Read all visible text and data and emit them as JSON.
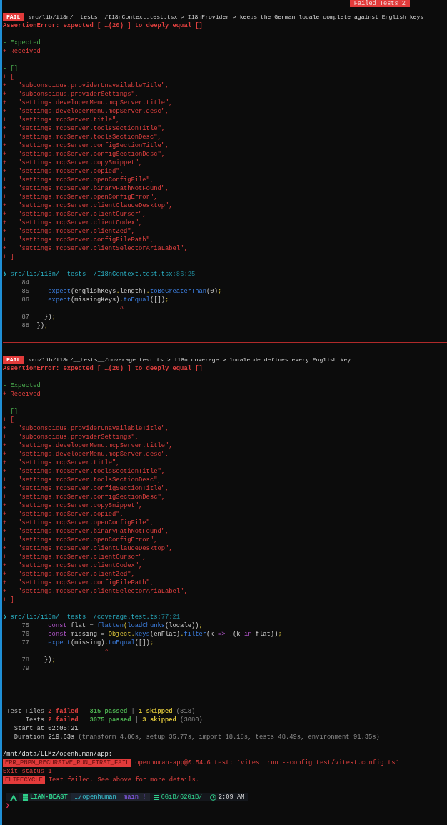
{
  "top_badge": {
    "label": "Failed Tests 2"
  },
  "failures": [
    {
      "badge": "FAIL",
      "header": "src/lib/i18n/__tests__/I18nContext.test.tsx > I18nProvider > keeps the German locale complete against English keys",
      "error": "AssertionError: expected [ …(20) ] to deeply equal []",
      "legend": [
        {
          "kind": "removed",
          "text": "- Expected"
        },
        {
          "kind": "added",
          "text": "+ Received"
        }
      ],
      "diff": [
        {
          "kind": "removed",
          "text": "- []"
        },
        {
          "kind": "added",
          "text": "+ ["
        },
        {
          "kind": "added",
          "text": "+   \"subconscious.providerUnavailableTitle\","
        },
        {
          "kind": "added",
          "text": "+   \"subconscious.providerSettings\","
        },
        {
          "kind": "added",
          "text": "+   \"settings.developerMenu.mcpServer.title\","
        },
        {
          "kind": "added",
          "text": "+   \"settings.developerMenu.mcpServer.desc\","
        },
        {
          "kind": "added",
          "text": "+   \"settings.mcpServer.title\","
        },
        {
          "kind": "added",
          "text": "+   \"settings.mcpServer.toolsSectionTitle\","
        },
        {
          "kind": "added",
          "text": "+   \"settings.mcpServer.toolsSectionDesc\","
        },
        {
          "kind": "added",
          "text": "+   \"settings.mcpServer.configSectionTitle\","
        },
        {
          "kind": "added",
          "text": "+   \"settings.mcpServer.configSectionDesc\","
        },
        {
          "kind": "added",
          "text": "+   \"settings.mcpServer.copySnippet\","
        },
        {
          "kind": "added",
          "text": "+   \"settings.mcpServer.copied\","
        },
        {
          "kind": "added",
          "text": "+   \"settings.mcpServer.openConfigFile\","
        },
        {
          "kind": "added",
          "text": "+   \"settings.mcpServer.binaryPathNotFound\","
        },
        {
          "kind": "added",
          "text": "+   \"settings.mcpServer.openConfigError\","
        },
        {
          "kind": "added",
          "text": "+   \"settings.mcpServer.clientClaudeDesktop\","
        },
        {
          "kind": "added",
          "text": "+   \"settings.mcpServer.clientCursor\","
        },
        {
          "kind": "added",
          "text": "+   \"settings.mcpServer.clientCodex\","
        },
        {
          "kind": "added",
          "text": "+   \"settings.mcpServer.clientZed\","
        },
        {
          "kind": "added",
          "text": "+   \"settings.mcpServer.configFilePath\","
        },
        {
          "kind": "added",
          "text": "+   \"settings.mcpServer.clientSelectorAriaLabel\","
        },
        {
          "kind": "added",
          "text": "+ ]"
        }
      ],
      "location": {
        "marker": "❯",
        "path": "src/lib/i18n/__tests__/I18nContext.test.tsx",
        "position": ":86:25"
      },
      "code": [
        {
          "gutter": "84|"
        },
        {
          "gutter": "85|",
          "tokens": [
            {
              "kind": "fn",
              "t": "    expect"
            },
            {
              "kind": "plain",
              "t": "(englishKeys"
            },
            {
              "kind": "punct",
              "t": "."
            },
            {
              "kind": "plain",
              "t": "length)"
            },
            {
              "kind": "punct",
              "t": "."
            },
            {
              "kind": "fn",
              "t": "toBeGreaterThan"
            },
            {
              "kind": "plain",
              "t": "(0)"
            },
            {
              "kind": "punct",
              "t": ";"
            }
          ]
        },
        {
          "gutter": "86|",
          "tokens": [
            {
              "kind": "fn",
              "t": "    expect"
            },
            {
              "kind": "plain",
              "t": "(missingKeys)"
            },
            {
              "kind": "punct",
              "t": "."
            },
            {
              "kind": "fn",
              "t": "toEqual"
            },
            {
              "kind": "plain",
              "t": "([])"
            },
            {
              "kind": "punct",
              "t": ";"
            }
          ]
        },
        {
          "gutter": "|",
          "caret": "                       ^"
        },
        {
          "gutter": "87|",
          "tokens": [
            {
              "kind": "plain",
              "t": "   })"
            },
            {
              "kind": "punct",
              "t": ";"
            }
          ]
        },
        {
          "gutter": "88|",
          "tokens": [
            {
              "kind": "plain",
              "t": " })"
            },
            {
              "kind": "punct",
              "t": ";"
            }
          ]
        }
      ]
    },
    {
      "badge": "FAIL",
      "header": "src/lib/i18n/__tests__/coverage.test.ts > i18n coverage > locale de defines every English key",
      "error": "AssertionError: expected [ …(20) ] to deeply equal []",
      "legend": [
        {
          "kind": "removed",
          "text": "- Expected"
        },
        {
          "kind": "added",
          "text": "+ Received"
        }
      ],
      "diff": [
        {
          "kind": "removed",
          "text": "- []"
        },
        {
          "kind": "added",
          "text": "+ ["
        },
        {
          "kind": "added",
          "text": "+   \"subconscious.providerUnavailableTitle\","
        },
        {
          "kind": "added",
          "text": "+   \"subconscious.providerSettings\","
        },
        {
          "kind": "added",
          "text": "+   \"settings.developerMenu.mcpServer.title\","
        },
        {
          "kind": "added",
          "text": "+   \"settings.developerMenu.mcpServer.desc\","
        },
        {
          "kind": "added",
          "text": "+   \"settings.mcpServer.title\","
        },
        {
          "kind": "added",
          "text": "+   \"settings.mcpServer.toolsSectionTitle\","
        },
        {
          "kind": "added",
          "text": "+   \"settings.mcpServer.toolsSectionDesc\","
        },
        {
          "kind": "added",
          "text": "+   \"settings.mcpServer.configSectionTitle\","
        },
        {
          "kind": "added",
          "text": "+   \"settings.mcpServer.configSectionDesc\","
        },
        {
          "kind": "added",
          "text": "+   \"settings.mcpServer.copySnippet\","
        },
        {
          "kind": "added",
          "text": "+   \"settings.mcpServer.copied\","
        },
        {
          "kind": "added",
          "text": "+   \"settings.mcpServer.openConfigFile\","
        },
        {
          "kind": "added",
          "text": "+   \"settings.mcpServer.binaryPathNotFound\","
        },
        {
          "kind": "added",
          "text": "+   \"settings.mcpServer.openConfigError\","
        },
        {
          "kind": "added",
          "text": "+   \"settings.mcpServer.clientClaudeDesktop\","
        },
        {
          "kind": "added",
          "text": "+   \"settings.mcpServer.clientCursor\","
        },
        {
          "kind": "added",
          "text": "+   \"settings.mcpServer.clientCodex\","
        },
        {
          "kind": "added",
          "text": "+   \"settings.mcpServer.clientZed\","
        },
        {
          "kind": "added",
          "text": "+   \"settings.mcpServer.configFilePath\","
        },
        {
          "kind": "added",
          "text": "+   \"settings.mcpServer.clientSelectorAriaLabel\","
        },
        {
          "kind": "added",
          "text": "+ ]"
        }
      ],
      "location": {
        "marker": "❯",
        "path": "src/lib/i18n/__tests__/coverage.test.ts",
        "position": ":77:21"
      },
      "code": [
        {
          "gutter": "75|",
          "tokens": [
            {
              "kind": "keyword",
              "t": "    const"
            },
            {
              "kind": "plain",
              "t": " flat = "
            },
            {
              "kind": "fn",
              "t": "flatten"
            },
            {
              "kind": "punct",
              "t": "("
            },
            {
              "kind": "fn",
              "t": "loadChunks"
            },
            {
              "kind": "plain",
              "t": "(locale))"
            },
            {
              "kind": "punct",
              "t": ";"
            }
          ]
        },
        {
          "gutter": "76|",
          "tokens": [
            {
              "kind": "keyword",
              "t": "    const"
            },
            {
              "kind": "plain",
              "t": " missing = "
            },
            {
              "kind": "punct",
              "t": "Object."
            },
            {
              "kind": "fn",
              "t": "keys"
            },
            {
              "kind": "plain",
              "t": "(enFlat)"
            },
            {
              "kind": "punct",
              "t": "."
            },
            {
              "kind": "fn",
              "t": "filter"
            },
            {
              "kind": "plain",
              "t": "(k "
            },
            {
              "kind": "keyword",
              "t": "=>"
            },
            {
              "kind": "plain",
              "t": " !(k "
            },
            {
              "kind": "keyword",
              "t": "in"
            },
            {
              "kind": "plain",
              "t": " flat))"
            },
            {
              "kind": "punct",
              "t": ";"
            }
          ]
        },
        {
          "gutter": "77|",
          "tokens": [
            {
              "kind": "fn",
              "t": "    expect"
            },
            {
              "kind": "plain",
              "t": "(missing)"
            },
            {
              "kind": "punct",
              "t": "."
            },
            {
              "kind": "fn",
              "t": "toEqual"
            },
            {
              "kind": "plain",
              "t": "([])"
            },
            {
              "kind": "punct",
              "t": ";"
            }
          ]
        },
        {
          "gutter": "|",
          "caret": "                   ^"
        },
        {
          "gutter": "78|",
          "tokens": [
            {
              "kind": "plain",
              "t": "   })"
            },
            {
              "kind": "punct",
              "t": ";"
            }
          ]
        },
        {
          "gutter": "79|"
        }
      ]
    }
  ],
  "summary": [
    {
      "label": "Test Files",
      "parts": [
        {
          "kind": "fail",
          "t": "2 failed"
        },
        {
          "kind": "dim",
          "t": " | "
        },
        {
          "kind": "pass",
          "t": "315 passed"
        },
        {
          "kind": "dim",
          "t": " | "
        },
        {
          "kind": "skip",
          "t": "1 skipped"
        },
        {
          "kind": "dim",
          "t": " (318)"
        }
      ]
    },
    {
      "label": "Tests",
      "parts": [
        {
          "kind": "fail",
          "t": "2 failed"
        },
        {
          "kind": "dim",
          "t": " | "
        },
        {
          "kind": "pass",
          "t": "3075 passed"
        },
        {
          "kind": "dim",
          "t": " | "
        },
        {
          "kind": "skip",
          "t": "3 skipped"
        },
        {
          "kind": "dim",
          "t": " (3080)"
        }
      ]
    },
    {
      "label": "Start at",
      "parts": [
        {
          "kind": "plain",
          "t": "02:05:21"
        }
      ]
    },
    {
      "label": "Duration",
      "parts": [
        {
          "kind": "plain",
          "t": "219.63s"
        },
        {
          "kind": "dim",
          "t": " (transform 4.86s, setup 35.77s, import 18.18s, tests 48.49s, environment 91.35s)"
        }
      ]
    }
  ],
  "cwd": "/mnt/data/LLMz/openhuman/app:",
  "errors": [
    {
      "kind": "badge",
      "badge": "ERR_PNPM_RECURSIVE_RUN_FIRST_FAIL",
      "text": "openhuman-app@0.54.6 test: `vitest run --config test/vitest.config.ts`"
    },
    {
      "kind": "plain",
      "text": "Exit status 1"
    },
    {
      "kind": "badge",
      "badge": "ELIFECYCLE",
      "text": "Test failed. See above for more details."
    }
  ],
  "prompt": {
    "segments": [
      {
        "kind": "host",
        "text": "LIAN-BEAST"
      },
      {
        "kind": "dir",
        "text": "…/openhuman"
      },
      {
        "kind": "git",
        "text": "main !"
      },
      {
        "kind": "memory",
        "text": "6GiB/62GiB/"
      },
      {
        "kind": "time",
        "text": "2:09 AM"
      }
    ],
    "cursor": "❯"
  }
}
